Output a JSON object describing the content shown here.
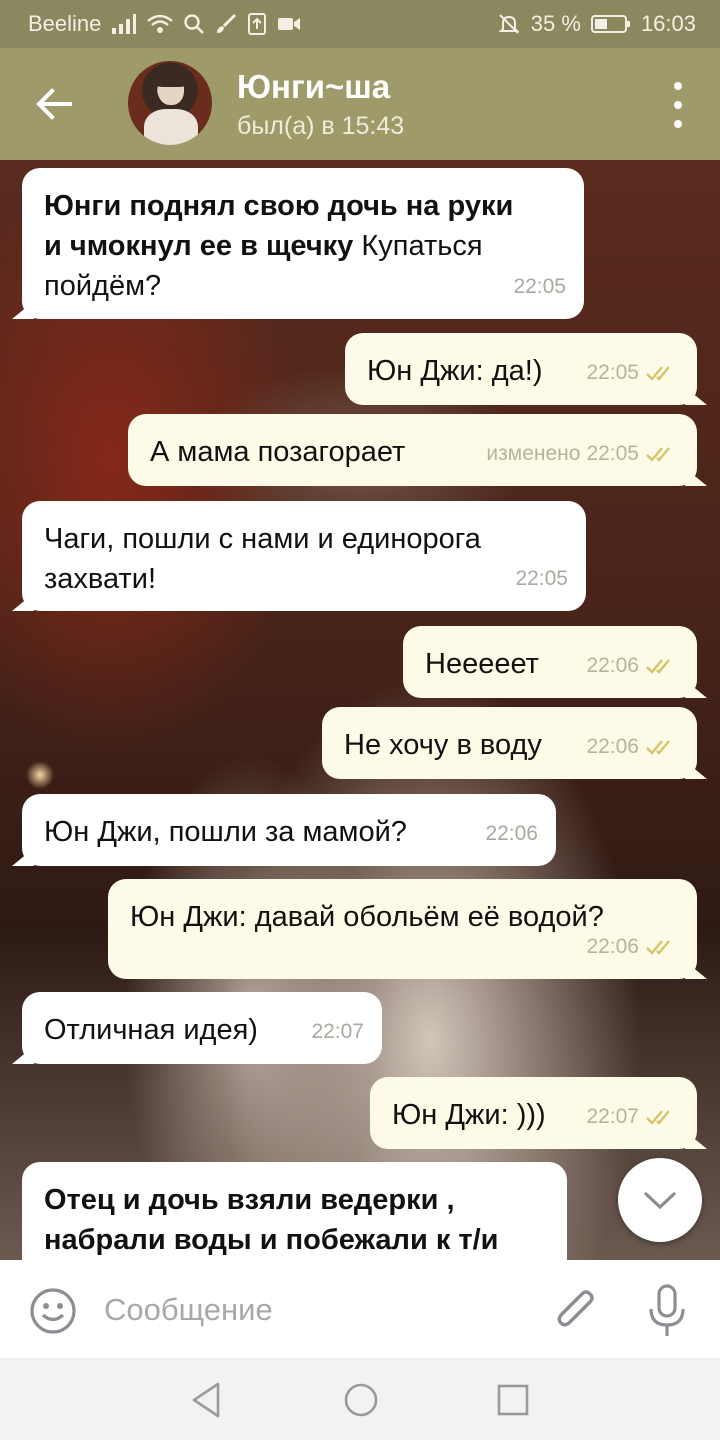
{
  "status_bar": {
    "carrier": "Beeline",
    "battery": "35 %",
    "time": "16:03"
  },
  "header": {
    "contact_name": "Юнги~ша",
    "last_seen": "был(а) в 15:43"
  },
  "messages": [
    {
      "direction": "in",
      "bold": "Юнги поднял свою дочь на руки",
      "bold2": "и чмокнул ее в щечку",
      "text": " Купаться",
      "text2": "пойдём?",
      "time": "22:05"
    },
    {
      "direction": "out",
      "text": "Юн Джи: да!)",
      "time": "22:05",
      "read": true
    },
    {
      "direction": "out",
      "text": "А мама позагорает",
      "edited": "изменено",
      "time": "22:05",
      "read": true
    },
    {
      "direction": "in",
      "text": "Чаги, пошли с нами и единорога",
      "text2": "захвати!",
      "time": "22:05"
    },
    {
      "direction": "out",
      "text": "Нееееет",
      "time": "22:06",
      "read": true
    },
    {
      "direction": "out",
      "text": "Не хочу в воду",
      "time": "22:06",
      "read": true
    },
    {
      "direction": "in",
      "text": "Юн Джи, пошли за мамой?",
      "time": "22:06"
    },
    {
      "direction": "out",
      "text": "Юн Джи: давай обольём её водой?",
      "time": "22:06",
      "read": true
    },
    {
      "direction": "in",
      "text": "Отличная идея)",
      "time": "22:07"
    },
    {
      "direction": "out",
      "text": "Юн Джи: )))",
      "time": "22:07",
      "read": true
    },
    {
      "direction": "in",
      "bold": "Отец и дочь взяли ведерки ,",
      "bold2": "набрали воды и побежали к т/и"
    }
  ],
  "input": {
    "placeholder": "Сообщение"
  },
  "colors": {
    "header": "#9f9a6a",
    "status_bar": "#8b875e",
    "outgoing_bubble": "#fdfbe7",
    "incoming_bubble": "#ffffff",
    "read_check": "#d4c46a"
  },
  "icons": {
    "back": "arrow-left-icon",
    "menu": "more-vertical-icon",
    "scroll": "chevron-down-icon",
    "emoji": "smile-icon",
    "attach": "paperclip-icon",
    "mic": "microphone-icon"
  }
}
